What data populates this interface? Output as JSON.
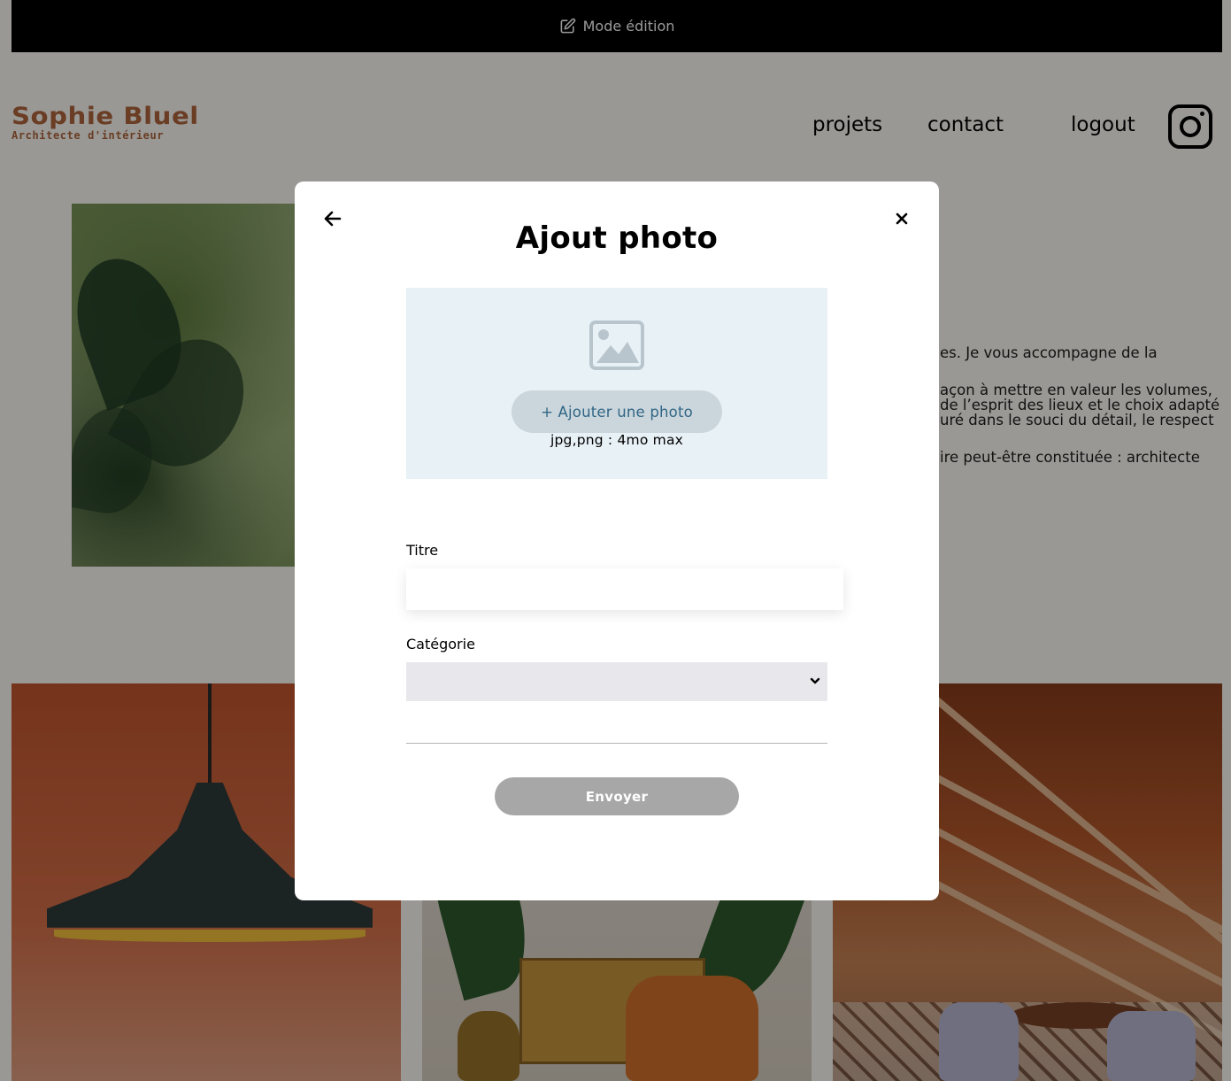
{
  "edit_banner": {
    "label": "Mode édition",
    "icon": "edit-icon"
  },
  "header": {
    "logo_title": "Sophie Bluel",
    "logo_subtitle": "Architecte d'intérieur",
    "nav": {
      "projets": "projets",
      "contact": "contact",
      "logout": "logout"
    },
    "social_icon": "instagram-icon"
  },
  "intro": {
    "lines": [
      "es. Je vous accompagne de la",
      "açon à mettre en valeur les volumes,",
      " de l’esprit des lieux et le choix adapté",
      "uré dans le souci du détail, le respect",
      "ire peut-être constituée : architecte"
    ]
  },
  "modal": {
    "title": "Ajout photo",
    "back_icon": "arrow-left-icon",
    "close_icon": "close-icon",
    "upload": {
      "icon": "image-icon",
      "button_label": "+ Ajouter une photo",
      "hint": "jpg,png : 4mo max"
    },
    "form": {
      "title_label": "Titre",
      "title_value": "",
      "category_label": "Catégorie",
      "category_value": "",
      "submit_label": "Envoyer"
    }
  },
  "colors": {
    "brand": "#b1663c",
    "upload_bg": "#e8f1f6",
    "upload_button_bg": "#cbd6dc",
    "upload_button_text": "#306685",
    "submit_disabled": "#a7a7a7",
    "overlay": "rgba(0,0,0,0.4)"
  }
}
